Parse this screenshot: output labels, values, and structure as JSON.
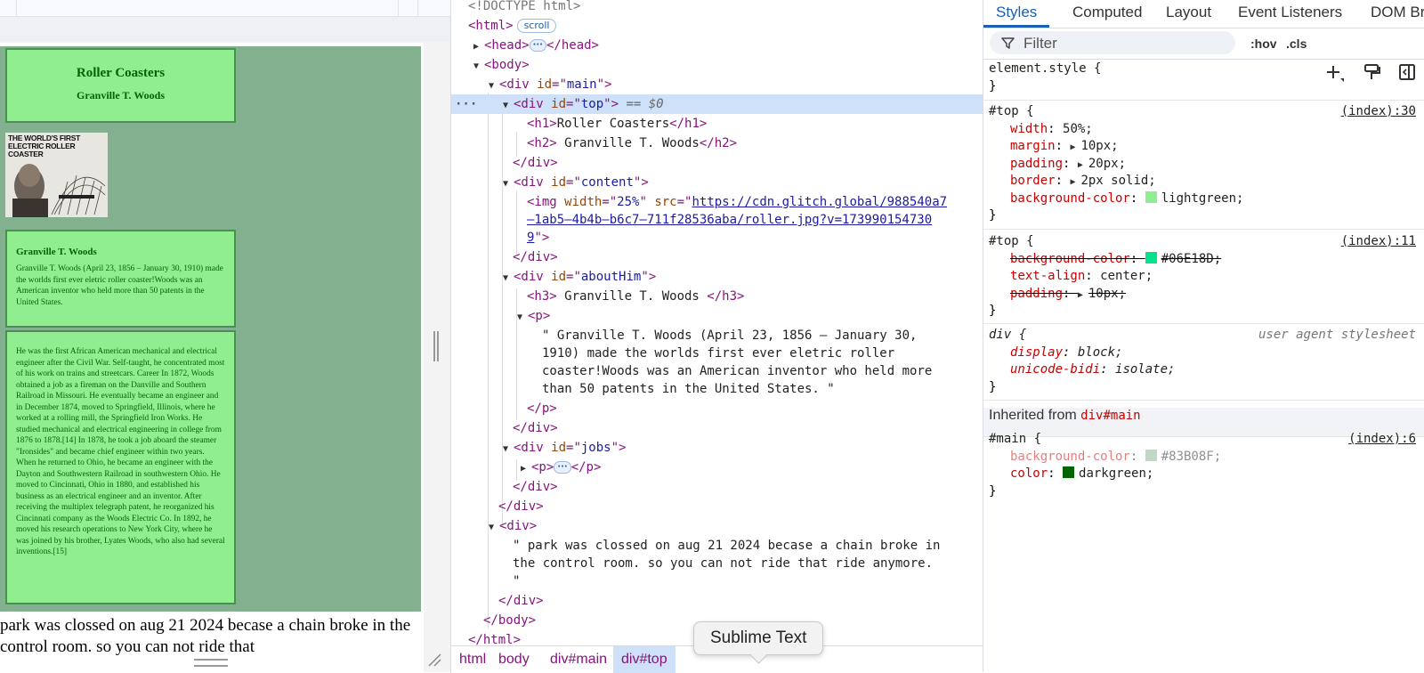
{
  "preview": {
    "title": "Roller Coasters",
    "subtitle": "Granville T. Woods",
    "image_caption": "THE WORLD'S FIRST ELECTRIC ROLLER COASTER",
    "about_heading": "Granville T. Woods",
    "about_text": "Granville T. Woods (April 23, 1856 – January 30, 1910) made the worlds first ever eletric roller coaster!Woods was an American inventor who held more than 50 patents in the United States.",
    "jobs_text": "He was the first African American mechanical and electrical engineer after the Civil War. Self-taught, he concentrated most of his work on trains and streetcars. Career In 1872, Woods obtained a job as a fireman on the Danville and Southern Railroad in Missouri. He eventually became an engineer and in December 1874, moved to Springfield, Illinois, where he worked at a rolling mill, the Springfield Iron Works. He studied mechanical and electrical engineering in college from 1876 to 1878.[14] In 1878, he took a job aboard the steamer \"Ironsides\" and became chief engineer within two years. When he returned to Ohio, he became an engineer with the Dayton and Southwestern Railroad in southwestern Ohio. He moved to Cincinnati, Ohio in 1880, and established his business as an electrical engineer and an inventor. After receiving the multiplex telegraph patent, he reorganized his Cincinnati company as the Woods Electric Co. In 1892, he moved his research operations to New York City, where he was joined by his brother, Lyates Woods, who also had several inventions.[15]",
    "bottom_text": "park was clossed on aug 21 2024 becase a chain broke in the control room. so you can not ride that"
  },
  "elements": {
    "doctype": "<!DOCTYPE html>",
    "scroll_badge": "scroll",
    "selected_marker": "== $0",
    "img_url_1": "https://cdn.glitch.global/988540a7",
    "img_url_2": "–1ab5–4b4b–b6c7–711f28536aba/roller.jpg?v=173990154730",
    "img_url_3": "9",
    "h1_text": "Roller Coasters",
    "h2_text": " Granville T. Woods",
    "h3_text": " Granville T. Woods ",
    "p_line1": "\" Granville T. Woods (April 23, 1856 – January 30,",
    "p_line2": "1910) made the worlds first ever eletric roller",
    "p_line3": "coaster!Woods was an American inventor who held more",
    "p_line4": "than 50 patents in the United States. \"",
    "park_line1": "\" park was clossed on aug 21 2024 becase a chain broke in",
    "park_line2": "the control room. so you can not ride that ride anymore.",
    "park_line3": "\""
  },
  "breadcrumbs": [
    "html",
    "body",
    "div#main",
    "div#top"
  ],
  "tooltip": "Sublime Text",
  "styles_tabs": [
    "Styles",
    "Computed",
    "Layout",
    "Event Listeners",
    "DOM Br"
  ],
  "filter": {
    "placeholder": "Filter",
    "hov": ":hov",
    "cls": ".cls"
  },
  "rules": {
    "element_style": "element.style {",
    "top1_selector": "#top {",
    "top1_source": "(index):30",
    "top1_props": [
      {
        "name": "width",
        "value": "50%;"
      },
      {
        "name": "margin",
        "value": "10px;"
      },
      {
        "name": "padding",
        "value": "20px;"
      },
      {
        "name": "border",
        "value": "2px solid;"
      },
      {
        "name": "background-color",
        "value": "lightgreen;",
        "color": "#90EE90"
      }
    ],
    "top2_selector": "#top {",
    "top2_source": "(index):11",
    "top2_props": [
      {
        "name": "background-color",
        "value": "#06E18D;",
        "color": "#06E18D"
      },
      {
        "name": "text-align",
        "value": "center;"
      },
      {
        "name": "padding",
        "value": "10px;"
      }
    ],
    "div_selector": "div {",
    "div_source": "user agent stylesheet",
    "div_props": [
      {
        "name": "display",
        "value": "block;"
      },
      {
        "name": "unicode-bidi",
        "value": "isolate;"
      }
    ],
    "inherited_label": "Inherited from",
    "inherited_selector": "div#main",
    "main_selector": "#main {",
    "main_source": "(index):6",
    "main_props": [
      {
        "name": "background-color",
        "value": "#83B08F;",
        "color": "#83B08F"
      },
      {
        "name": "color",
        "value": "darkgreen;",
        "color": "#006400"
      }
    ],
    "close_brace": "}"
  },
  "colors": {
    "accent": "#1a5fb4",
    "selection": "#cfe1f9",
    "tag": "#881280",
    "property": "#c80000"
  }
}
